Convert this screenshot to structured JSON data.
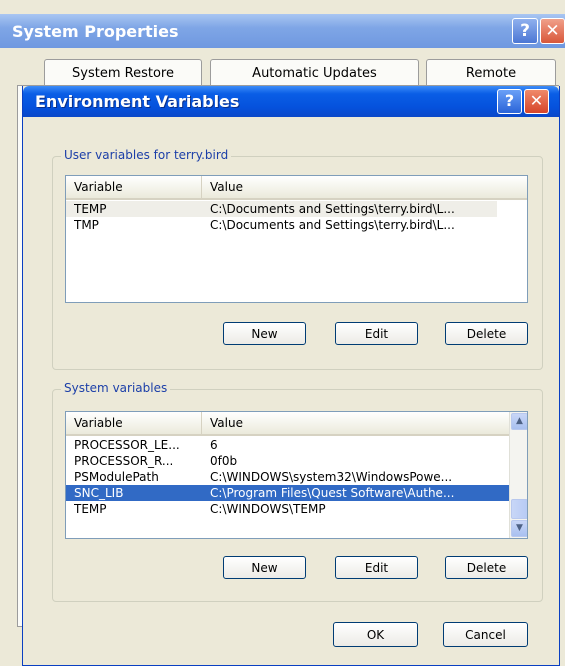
{
  "back_window": {
    "title": "System Properties",
    "help_glyph": "?",
    "close_glyph": "✕",
    "tabs": [
      {
        "label": "System Restore"
      },
      {
        "label": "Automatic Updates"
      },
      {
        "label": "Remote"
      }
    ]
  },
  "dialog": {
    "title": "Environment Variables",
    "help_glyph": "?",
    "close_glyph": "✕",
    "user_group": {
      "label": "User variables for terry.bird",
      "columns": {
        "variable": "Variable",
        "value": "Value"
      },
      "rows": [
        {
          "variable": "TEMP",
          "value": "C:\\Documents and Settings\\terry.bird\\L..."
        },
        {
          "variable": "TMP",
          "value": "C:\\Documents and Settings\\terry.bird\\L..."
        }
      ],
      "buttons": {
        "new": "New",
        "edit": "Edit",
        "delete": "Delete"
      }
    },
    "system_group": {
      "label": "System variables",
      "columns": {
        "variable": "Variable",
        "value": "Value"
      },
      "rows": [
        {
          "variable": "PROCESSOR_LE...",
          "value": "6"
        },
        {
          "variable": "PROCESSOR_R...",
          "value": "0f0b"
        },
        {
          "variable": "PSModulePath",
          "value": "C:\\WINDOWS\\system32\\WindowsPowe..."
        },
        {
          "variable": "SNC_LIB",
          "value": "C:\\Program Files\\Quest Software\\Authe..."
        },
        {
          "variable": "TEMP",
          "value": "C:\\WINDOWS\\TEMP"
        }
      ],
      "selected_row": "SNC_LIB",
      "buttons": {
        "new": "New",
        "edit": "Edit",
        "delete": "Delete"
      }
    },
    "footer": {
      "ok": "OK",
      "cancel": "Cancel"
    }
  },
  "icons": {
    "scroll_up": "scroll-up-arrow-icon",
    "scroll_down": "scroll-down-arrow-icon"
  },
  "colors": {
    "title_bar_active": "#0551dc",
    "title_bar_inactive": "#7fa6e6",
    "selection": "#316ac5",
    "group_label": "#1c3fa8"
  }
}
